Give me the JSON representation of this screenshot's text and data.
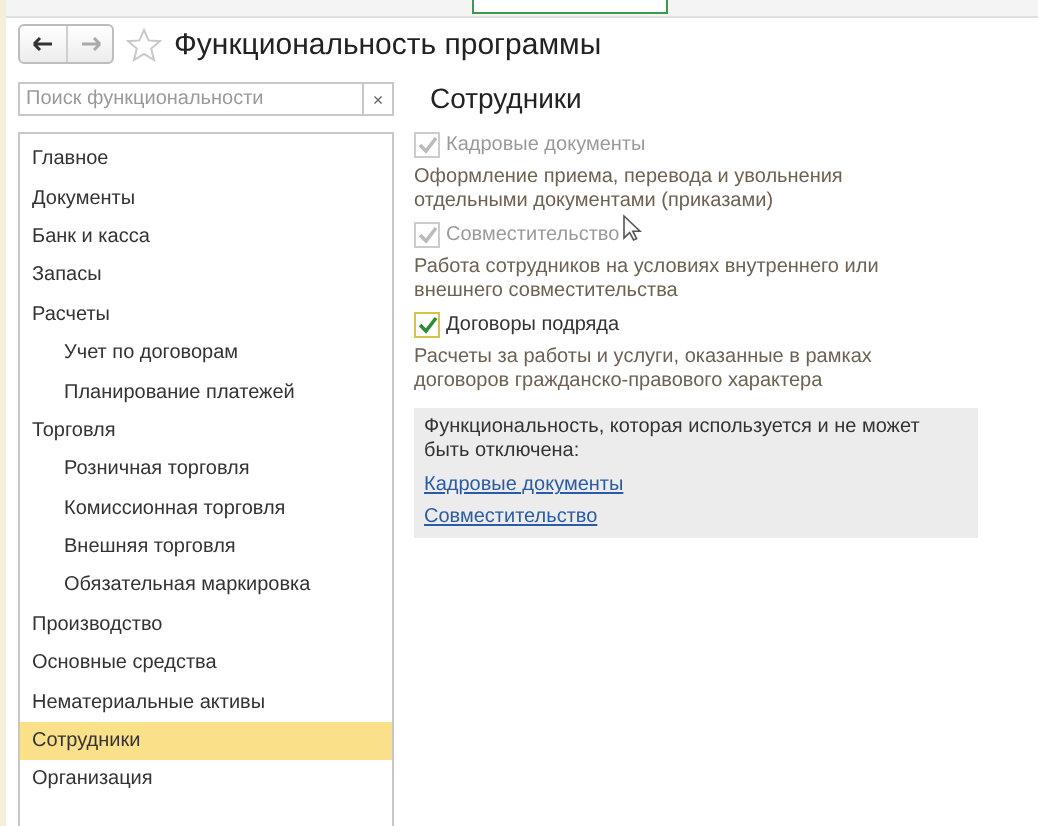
{
  "window": {
    "title": "Функциональность программы",
    "favorite": false
  },
  "search": {
    "placeholder": "Поиск функциональности",
    "clear": "×"
  },
  "sections": [
    {
      "label": "Главное",
      "selected": false
    },
    {
      "label": "Документы",
      "selected": false
    },
    {
      "label": "Банк и касса",
      "selected": false
    },
    {
      "label": "Запасы",
      "selected": false
    },
    {
      "label": "Расчеты",
      "selected": false,
      "children": [
        {
          "label": "Учет по договорам",
          "selected": false
        },
        {
          "label": "Планирование платежей",
          "selected": false
        }
      ]
    },
    {
      "label": "Торговля",
      "selected": false,
      "children": [
        {
          "label": "Розничная торговля",
          "selected": false
        },
        {
          "label": "Комиссионная торговля",
          "selected": false
        },
        {
          "label": "Внешняя торговля",
          "selected": false
        },
        {
          "label": "Обязательная маркировка",
          "selected": false
        }
      ]
    },
    {
      "label": "Производство",
      "selected": false
    },
    {
      "label": "Основные средства",
      "selected": false
    },
    {
      "label": "Нематериальные активы",
      "selected": false
    },
    {
      "label": "Сотрудники",
      "selected": true
    },
    {
      "label": "Организация",
      "selected": false
    }
  ],
  "panel": {
    "title": "Сотрудники",
    "options": [
      {
        "label": "Кадровые документы",
        "checked": true,
        "disabled": true,
        "description": "Оформление приема, перевода и увольнения отдельными документами (приказами)"
      },
      {
        "label": "Совместительство",
        "checked": true,
        "disabled": true,
        "description": "Работа сотрудников на условиях внутреннего или внешнего совместительства"
      },
      {
        "label": "Договоры подряда",
        "checked": true,
        "disabled": false,
        "description": "Расчеты за работы и услуги, оказанные в рамках договоров гражданско-правового характера"
      }
    ],
    "notice": {
      "text": "Функциональность, которая используется и не может быть отключена:",
      "links": [
        "Кадровые документы",
        "Совместительство"
      ]
    }
  }
}
